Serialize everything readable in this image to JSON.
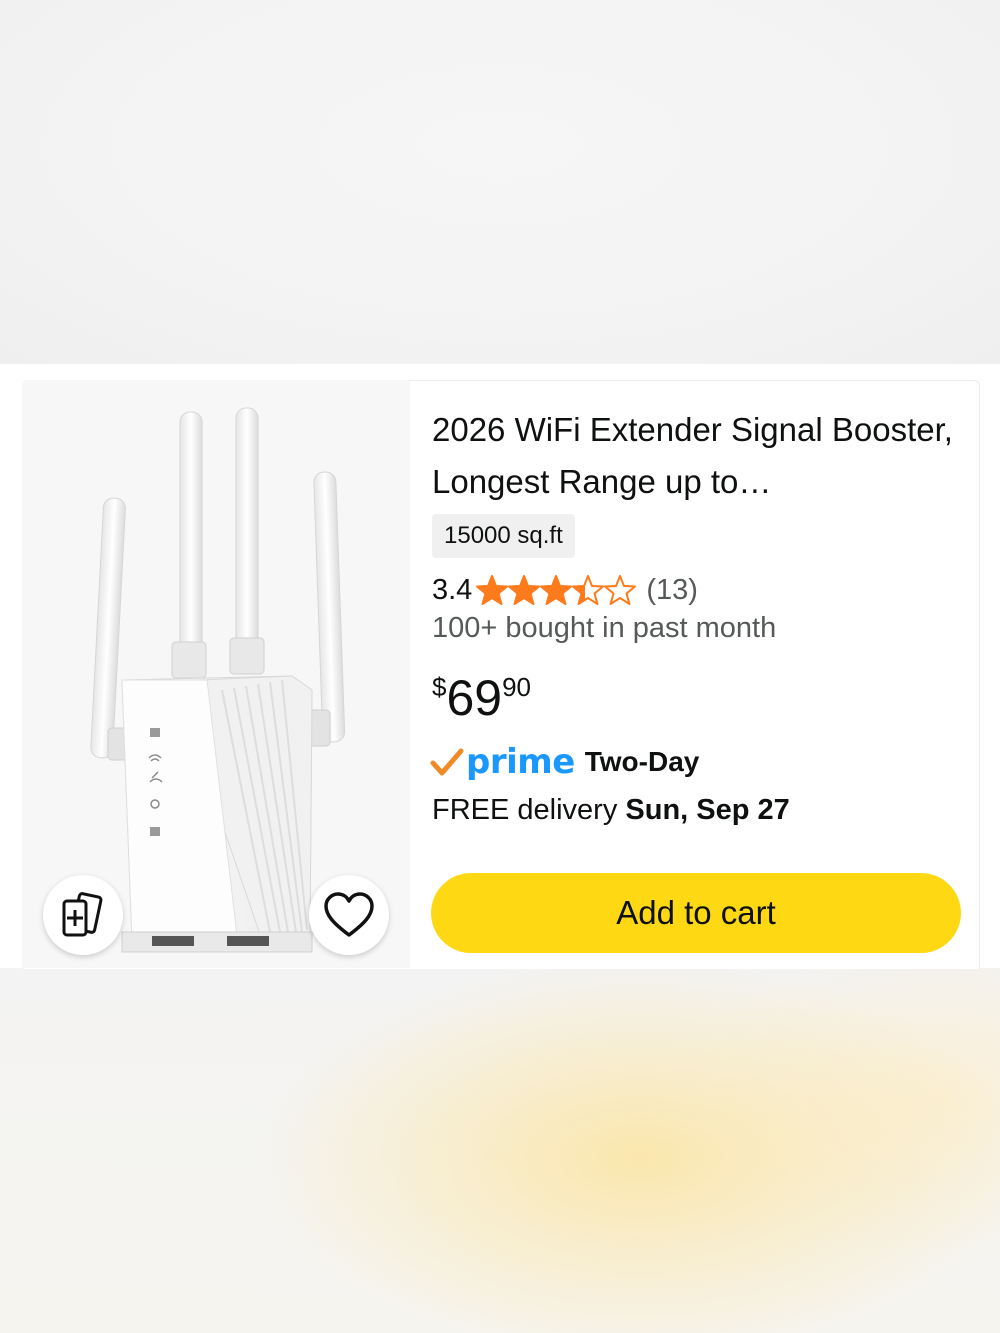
{
  "product": {
    "title": "2026 WiFi Extender Signal Booster, Longest Range up to…",
    "variant": "15000 sq.ft",
    "rating": "3.4",
    "rating_value": 3.4,
    "rating_max": 5,
    "review_count": "(13)",
    "bought": "100+ bought in past month",
    "price_symbol": "$",
    "price_whole": "69",
    "price_fraction": "90",
    "prime_label": "prime",
    "delivery_speed": "Two-Day",
    "delivery_prefix": "FREE delivery",
    "delivery_date": "Sun, Sep 27",
    "add_to_cart": "Add to cart"
  },
  "colors": {
    "star": "#ff7a1a",
    "prime_blue": "#1a98ff",
    "prime_check": "#f08a24",
    "cart_button": "#ffd814"
  },
  "icons": {
    "compare": "add-to-compare-icon",
    "wishlist": "heart-icon",
    "stars": "star-icon"
  }
}
